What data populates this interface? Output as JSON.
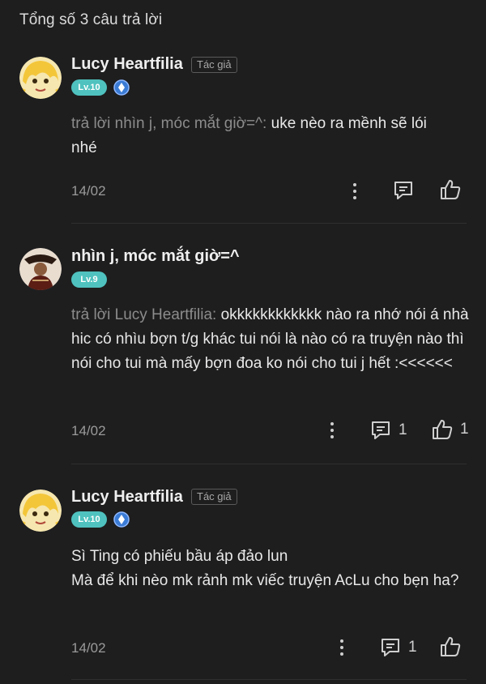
{
  "header": {
    "total_answers": "Tổng số 3 câu trả lời"
  },
  "comments": [
    {
      "author": "Lucy Heartfilia",
      "author_badge": "Tác giả",
      "level": "Lv.10",
      "has_gem": true,
      "reply_prefix": "trả lời nhìn j, móc mắt giờ=^: ",
      "text": "uke nèo ra mềnh sẽ lói nhé",
      "date": "14/02",
      "reply_count": "",
      "like_count": ""
    },
    {
      "author": "nhìn j, móc mắt giờ=^",
      "author_badge": "",
      "level": "Lv.9",
      "has_gem": false,
      "reply_prefix": "trả lời Lucy Heartfilia: ",
      "text": "okkkkkkkkkkkk nào ra nhớ nói á nhà hic có nhìu bợn t/g khác tui nói là nào có ra truyện nào thì nói cho tui mà mấy bợn đoa ko nói cho tui j hết :<<<<<<",
      "date": "14/02",
      "reply_count": "1",
      "like_count": "1"
    },
    {
      "author": "Lucy Heartfilia",
      "author_badge": "Tác giả",
      "level": "Lv.10",
      "has_gem": true,
      "reply_prefix": "",
      "text_line1": "Sì Ting có phiếu bầu áp đảo lun",
      "text_line2": "Mà để khi nèo mk rảnh mk viếc truyện AcLu cho bẹn ha?",
      "date": "14/02",
      "reply_count": "1",
      "like_count": ""
    }
  ],
  "colors": {
    "level_badge": "#4fc2bf",
    "gem": "#3a7bd5",
    "background": "#1e1e1f"
  },
  "icons": {
    "more": "more-vertical-icon",
    "reply": "comment-icon",
    "like": "thumbs-up-icon",
    "gem": "diamond-icon"
  }
}
